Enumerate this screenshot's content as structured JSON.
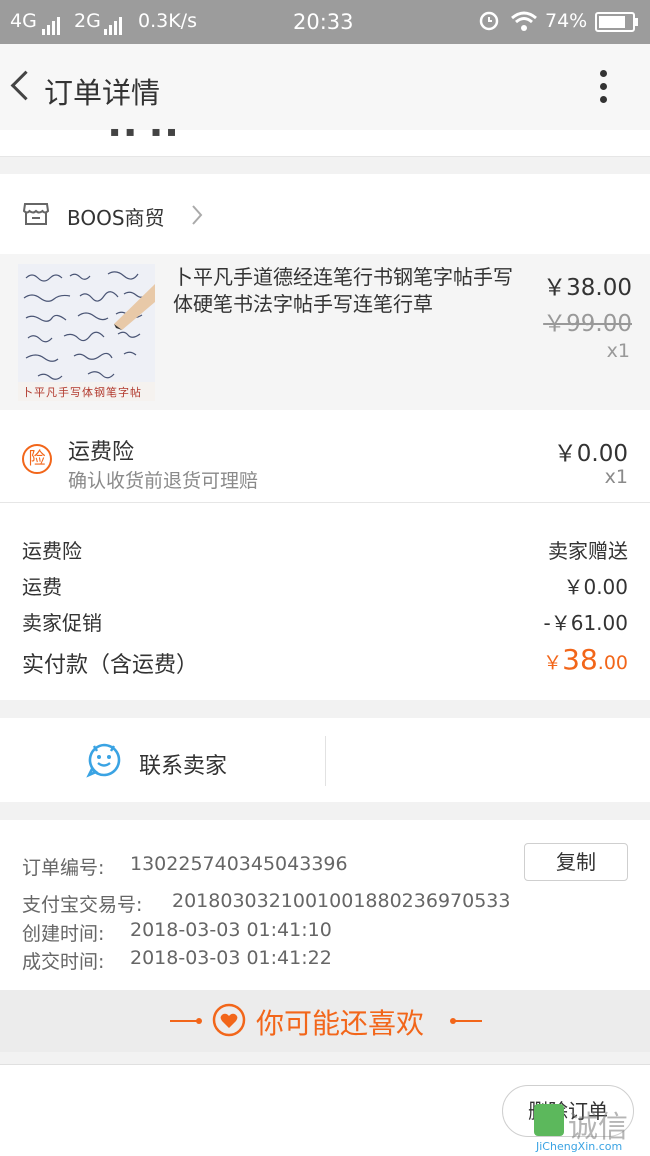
{
  "status_bar": {
    "left": "4G",
    "left2": "2G",
    "speed": "0.3K/s",
    "time": "20:33",
    "battery": "74%"
  },
  "app_bar": {
    "title": "订单详情"
  },
  "partial_text": "▪▪ ▪▪",
  "shop": {
    "name": "BOOS商贸"
  },
  "product": {
    "image_caption": "卜平凡手写体钢笔字帖",
    "title": "卜平凡手道德经连笔行书钢笔字帖手写体硬笔书法字帖手写连笔行草",
    "price": "￥38.00",
    "original_price": "￥99.00",
    "qty": "x1"
  },
  "insurance": {
    "badge": "险",
    "title": "运费险",
    "desc": "确认收货前退货可理赔",
    "price": "￥0.00",
    "qty": "x1"
  },
  "summary": {
    "rows": [
      {
        "label": "运费险",
        "value": "卖家赠送"
      },
      {
        "label": "运费",
        "value": "￥0.00"
      },
      {
        "label": "卖家促销",
        "value": "-￥61.00"
      }
    ],
    "total_label": "实付款（含运费）",
    "total_currency": "￥",
    "total_int": "38",
    "total_dec": ".00"
  },
  "contact": {
    "label": "联系卖家"
  },
  "order_info": {
    "order_no_label": "订单编号:",
    "order_no": "1302257403450433​96",
    "copy_label": "复制",
    "alipay_label": "支付宝交易号:",
    "alipay_no": "2018030321001001880236970533",
    "created_label": "创建时间:",
    "created": "2018-03-03 01:41:10",
    "deal_label": "成交时间:",
    "deal": "2018-03-03 01:41:22"
  },
  "recommend": {
    "label": "你可能还喜欢"
  },
  "footer": {
    "delete_label": "删除订单"
  },
  "watermark": {
    "text": "诚信",
    "site": "JiChengXin.com"
  },
  "colors": {
    "accent": "#f2661a",
    "status_bar": "#9c9c9c",
    "blue": "#3aa3e3"
  }
}
